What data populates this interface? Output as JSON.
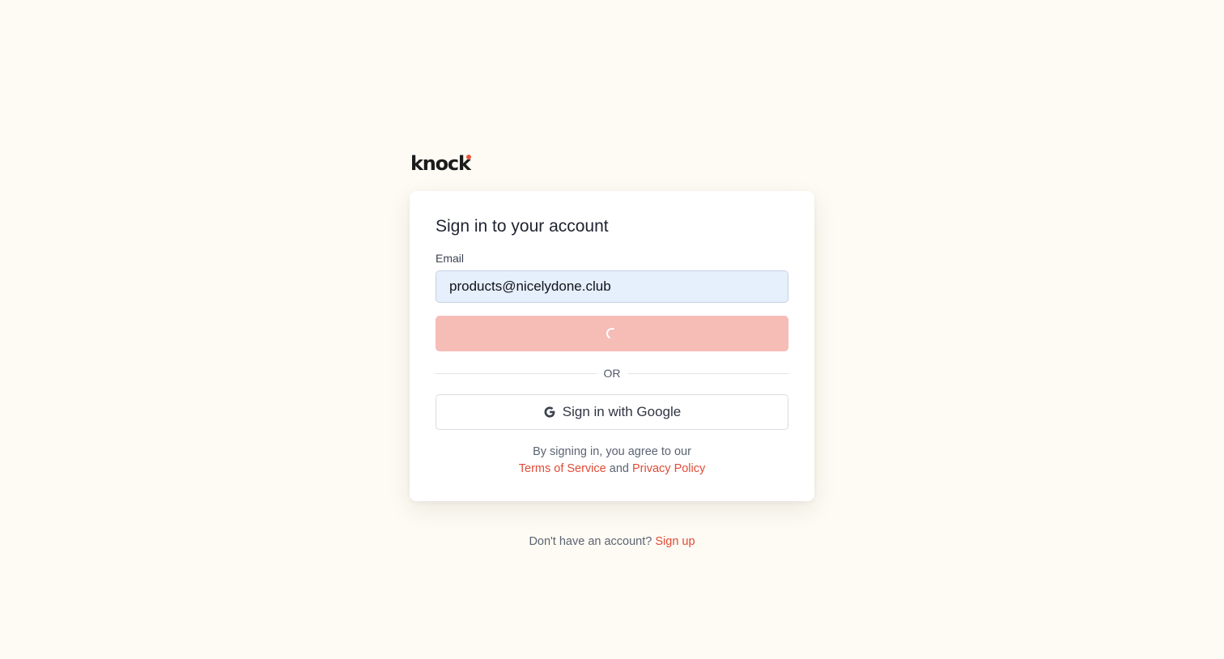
{
  "brand": {
    "logo_text": "knock",
    "accent_color": "#e9553f"
  },
  "signin": {
    "title": "Sign in to your account",
    "email_label": "Email",
    "email_value": "products@nicelydone.club",
    "submit_state": "loading",
    "divider_text": "OR",
    "google_button_label": "Sign in with Google",
    "terms_prefix": "By signing in, you agree to our",
    "terms_link": "Terms of Service",
    "terms_and": "and",
    "privacy_link": "Privacy Policy"
  },
  "footer": {
    "prompt": "Don't have an account?",
    "signup_link": "Sign up"
  },
  "icons": {
    "google": "google-g-icon",
    "spinner": "loading-spinner-icon"
  }
}
